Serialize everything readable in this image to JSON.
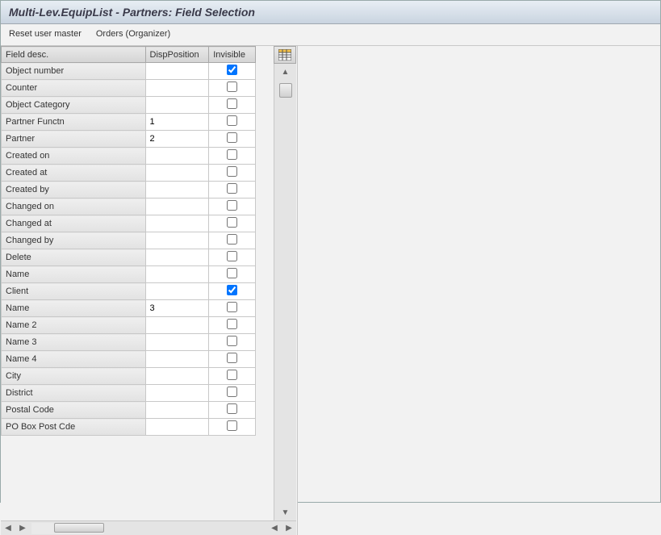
{
  "title": "Multi-Lev.EquipList - Partners: Field Selection",
  "toolbar": {
    "reset": "Reset user master",
    "orders": "Orders (Organizer)"
  },
  "columns": {
    "desc": "Field desc.",
    "pos": "DispPosition",
    "inv": "Invisible"
  },
  "rows": [
    {
      "desc": "Object number",
      "pos": "",
      "inv": true
    },
    {
      "desc": "Counter",
      "pos": "",
      "inv": false
    },
    {
      "desc": "Object Category",
      "pos": "",
      "inv": false
    },
    {
      "desc": "Partner Functn",
      "pos": "1",
      "inv": false
    },
    {
      "desc": "Partner",
      "pos": "2",
      "inv": false
    },
    {
      "desc": "Created on",
      "pos": "",
      "inv": false
    },
    {
      "desc": "Created at",
      "pos": "",
      "inv": false
    },
    {
      "desc": "Created by",
      "pos": "",
      "inv": false
    },
    {
      "desc": "Changed on",
      "pos": "",
      "inv": false
    },
    {
      "desc": "Changed at",
      "pos": "",
      "inv": false
    },
    {
      "desc": "Changed by",
      "pos": "",
      "inv": false
    },
    {
      "desc": "Delete",
      "pos": "",
      "inv": false
    },
    {
      "desc": "Name",
      "pos": "",
      "inv": false
    },
    {
      "desc": "Client",
      "pos": "",
      "inv": true
    },
    {
      "desc": "Name",
      "pos": "3",
      "inv": false
    },
    {
      "desc": "Name 2",
      "pos": "",
      "inv": false
    },
    {
      "desc": "Name 3",
      "pos": "",
      "inv": false
    },
    {
      "desc": "Name 4",
      "pos": "",
      "inv": false
    },
    {
      "desc": "City",
      "pos": "",
      "inv": false
    },
    {
      "desc": "District",
      "pos": "",
      "inv": false
    },
    {
      "desc": "Postal Code",
      "pos": "",
      "inv": false
    },
    {
      "desc": "PO Box Post Cde",
      "pos": "",
      "inv": false
    }
  ]
}
